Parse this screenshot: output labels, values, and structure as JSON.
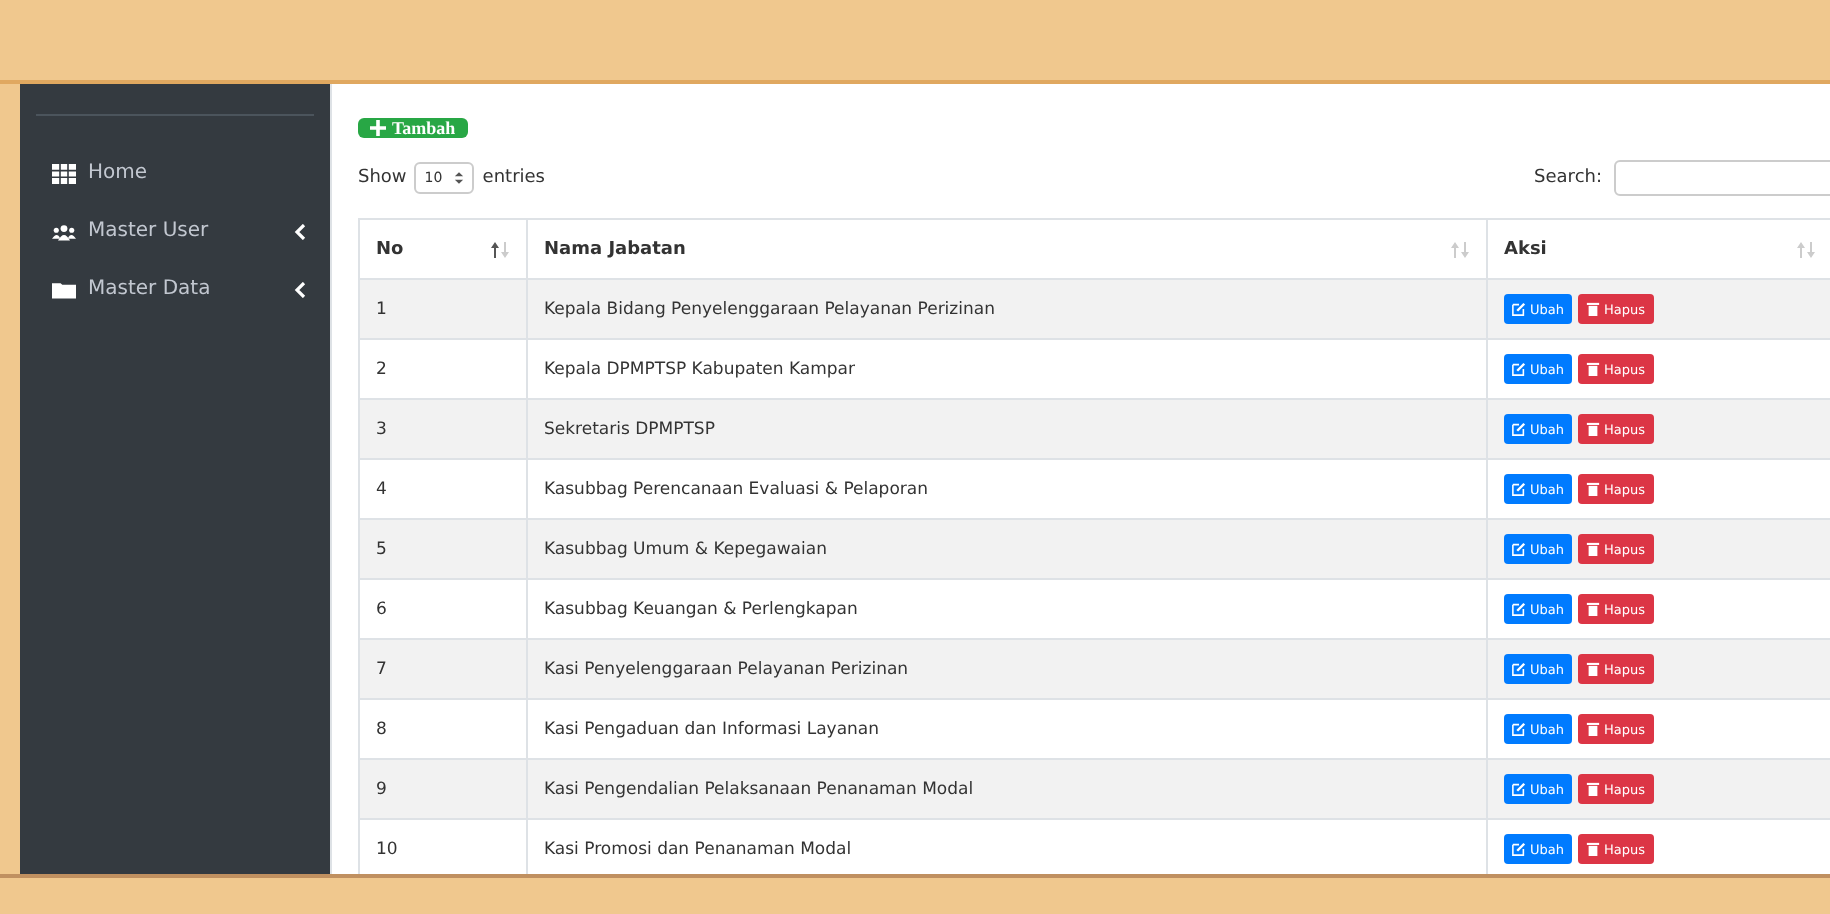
{
  "sidebar": {
    "items": [
      {
        "label": "Home",
        "submenu": false
      },
      {
        "label": "Master User",
        "submenu": true
      },
      {
        "label": "Master Data",
        "submenu": true
      }
    ]
  },
  "add_button": "Tambah",
  "length": {
    "before": "Show",
    "value": "10",
    "after": "entries"
  },
  "search": {
    "label": "Search:"
  },
  "table": {
    "columns": [
      "No",
      "Nama Jabatan",
      "Aksi"
    ],
    "rows": [
      {
        "no": "1",
        "name": "Kepala Bidang Penyelenggaraan Pelayanan Perizinan",
        "edit": "Ubah",
        "delete": "Hapus"
      },
      {
        "no": "2",
        "name": "Kepala DPMPTSP Kabupaten Kampar",
        "edit": "Ubah",
        "delete": "Hapus"
      },
      {
        "no": "3",
        "name": "Sekretaris DPMPTSP",
        "edit": "Ubah",
        "delete": "Hapus"
      },
      {
        "no": "4",
        "name": "Kasubbag Perencanaan Evaluasi & Pelaporan",
        "edit": "Ubah",
        "delete": "Hapus"
      },
      {
        "no": "5",
        "name": "Kasubbag Umum & Kepegawaian",
        "edit": "Ubah",
        "delete": "Hapus"
      },
      {
        "no": "6",
        "name": "Kasubbag Keuangan & Perlengkapan",
        "edit": "Ubah",
        "delete": "Hapus"
      },
      {
        "no": "7",
        "name": "Kasi Penyelenggaraan Pelayanan Perizinan",
        "edit": "Ubah",
        "delete": "Hapus"
      },
      {
        "no": "8",
        "name": "Kasi Pengaduan dan Informasi Layanan",
        "edit": "Ubah",
        "delete": "Hapus"
      },
      {
        "no": "9",
        "name": "Kasi Pengendalian Pelaksanaan Penanaman Modal",
        "edit": "Ubah",
        "delete": "Hapus"
      },
      {
        "no": "10",
        "name": "Kasi Promosi dan Penanaman Modal",
        "edit": "Ubah",
        "delete": "Hapus"
      }
    ]
  }
}
